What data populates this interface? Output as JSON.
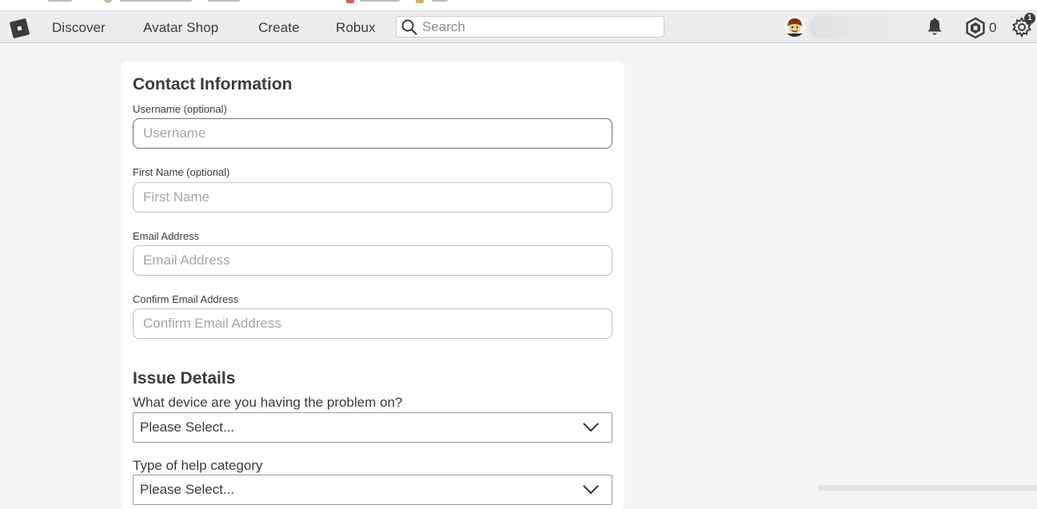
{
  "nav": {
    "links": [
      "Discover",
      "Avatar Shop",
      "Create",
      "Robux"
    ],
    "search_placeholder": "Search",
    "robux_count": "0",
    "settings_badge": "1"
  },
  "form": {
    "contact_title": "Contact Information",
    "fields": [
      {
        "label": "Username (optional)",
        "placeholder": "Username"
      },
      {
        "label": "First Name (optional)",
        "placeholder": "First Name"
      },
      {
        "label": "Email Address",
        "placeholder": "Email Address"
      },
      {
        "label": "Confirm Email Address",
        "placeholder": "Confirm Email Address"
      }
    ],
    "issue_title": "Issue Details",
    "device_question": "What device are you having the problem on?",
    "device_value": "Please Select...",
    "category_question": "Type of help category",
    "category_value": "Please Select..."
  },
  "colors": {
    "background": "#f2f4f5",
    "nav_background": "#ebeced",
    "text": "#393b3d"
  },
  "icons": [
    "roblox-logo-icon",
    "search-icon",
    "avatar-icon",
    "bell-icon",
    "robux-icon",
    "gear-icon",
    "chevron-down-icon"
  ]
}
